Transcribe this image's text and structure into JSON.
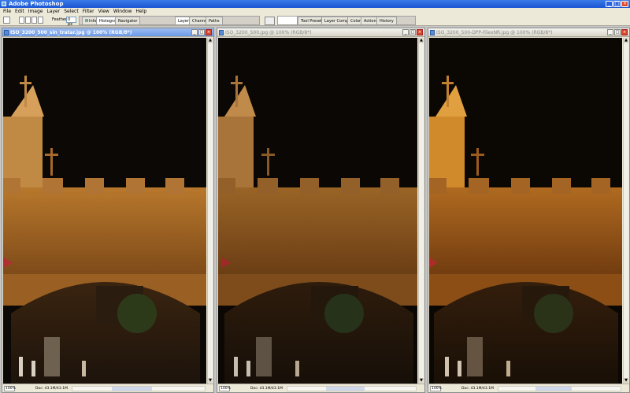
{
  "app": {
    "title": "Adobe Photoshop",
    "window_controls": [
      "_",
      "□",
      "×"
    ]
  },
  "menu": [
    "File",
    "Edit",
    "Image",
    "Layer",
    "Select",
    "Filter",
    "View",
    "Window",
    "Help"
  ],
  "options_bar": {
    "feather_label": "Feather:",
    "feather_value": "0 px"
  },
  "palette_tabs_left": [
    "Info",
    "Histogram",
    "Navigator"
  ],
  "palette_tabs_mid": [
    "Layers",
    "Channels",
    "Paths"
  ],
  "palette_tabs_right": [
    "Tool Presets",
    "Layer Comps",
    "Color",
    "Actions",
    "History"
  ],
  "documents": [
    {
      "title": "ISO_3200_500_sin_tratar.jpg @ 100% (RGB/8*)",
      "zoom": "100%",
      "doc": "Doc: 43.1M/43.1M",
      "active": true
    },
    {
      "title": "ISO_3200_500.jpg @ 100% (RGB/8*)",
      "zoom": "100%",
      "doc": "Doc: 43.1M/43.1M",
      "active": false
    },
    {
      "title": "ISO_3200_500-DPP-FilexNR.jpg @ 100% (RGB/8*)",
      "zoom": "100%",
      "doc": "Doc: 43.1M/43.1M",
      "active": false
    }
  ]
}
